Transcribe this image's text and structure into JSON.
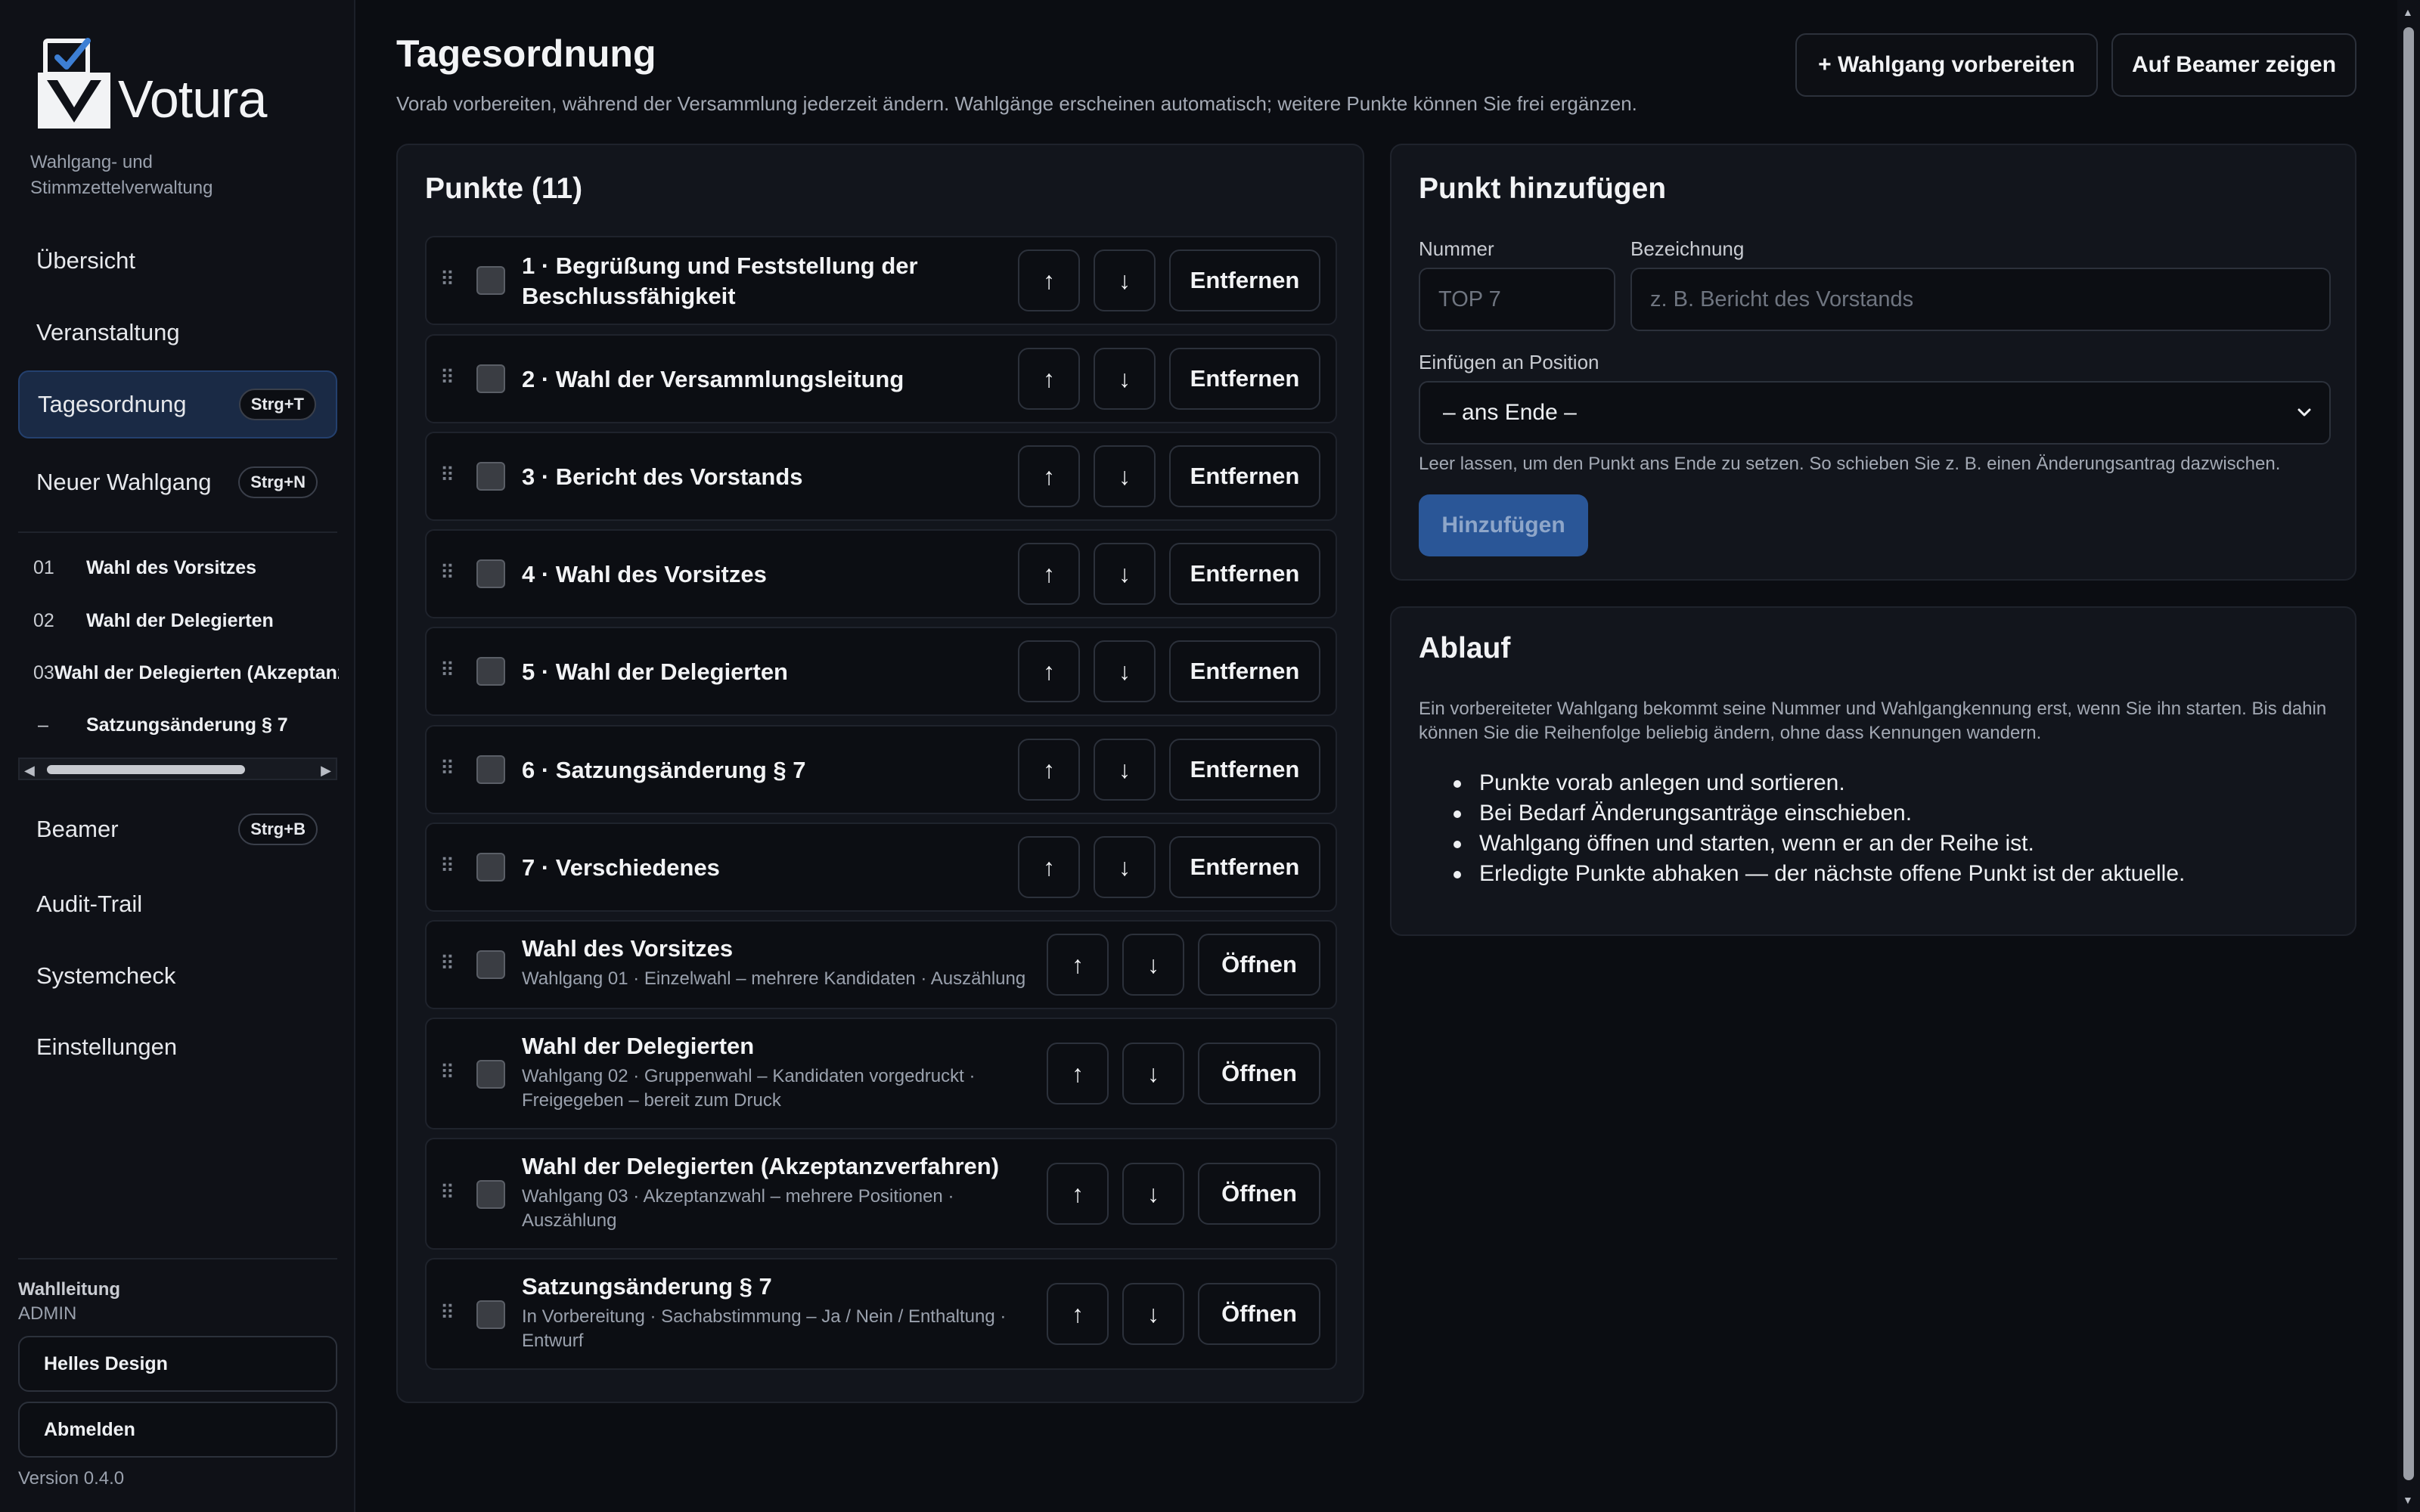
{
  "app": {
    "name": "Votura",
    "tagline": "Wahlgang- und Stimmzettelverwaltung"
  },
  "colors": {
    "background": "#0b0d12",
    "sidebar": "#0f1117",
    "panel": "#12151c",
    "accent": "#2a5697",
    "active_nav": "#1a2a45",
    "logo_check": "#3d7fd4"
  },
  "sidebar": {
    "nav": [
      {
        "label": "Übersicht"
      },
      {
        "label": "Veranstaltung"
      },
      {
        "label": "Tagesordnung",
        "shortcut": "Strg+T",
        "active": true
      },
      {
        "label": "Neuer Wahlgang",
        "shortcut": "Strg+N"
      }
    ],
    "ballots": [
      {
        "num": "01",
        "label": "Wahl des Vorsitzes"
      },
      {
        "num": "02",
        "label": "Wahl der Delegierten"
      },
      {
        "num": "03",
        "label": "Wahl der Delegierten (Akzeptanzverfahren)"
      },
      {
        "num": "–",
        "label": "Satzungsänderung § 7"
      }
    ],
    "nav2": [
      {
        "label": "Beamer",
        "shortcut": "Strg+B"
      },
      {
        "label": "Audit-Trail"
      },
      {
        "label": "Systemcheck"
      },
      {
        "label": "Einstellungen"
      }
    ],
    "user_role": "Wahlleitung",
    "user_name": "ADMIN",
    "theme_button": "Helles Design",
    "logout_button": "Abmelden",
    "version": "Version 0.4.0"
  },
  "header": {
    "title": "Tagesordnung",
    "subtitle": "Vorab vorbereiten, während der Versammlung jederzeit ändern. Wahlgänge erscheinen automatisch; weitere Punkte können Sie frei ergänzen.",
    "prepare_button": "+ Wahlgang vorbereiten",
    "beamer_button": "Auf Beamer zeigen"
  },
  "agenda": {
    "title": "Punkte (11)",
    "up_icon": "↑",
    "down_icon": "↓",
    "remove_label": "Entfernen",
    "open_label": "Öffnen",
    "items": [
      {
        "title_line1": "1 · Begrüßung und Feststellung der",
        "title_line2": "Beschlussfähigkeit"
      },
      {
        "title": "2 · Wahl der Versammlungsleitung"
      },
      {
        "title": "3 · Bericht des Vorstands"
      },
      {
        "title": "4 · Wahl des Vorsitzes"
      },
      {
        "title": "5 · Wahl der Delegierten"
      },
      {
        "title": "6 · Satzungsänderung § 7"
      },
      {
        "title": "7 · Verschiedenes"
      }
    ],
    "ballots": [
      {
        "title": "Wahl des Vorsitzes",
        "meta1": "Wahlgang 01 · Einzelwahl – mehrere Kandidaten · Auszählung"
      },
      {
        "title": "Wahl der Delegierten",
        "meta1": "Wahlgang 02 · Gruppenwahl – Kandidaten vorgedruckt ·",
        "meta2": "Freigegeben – bereit zum Druck"
      },
      {
        "title": "Wahl der Delegierten (Akzeptanzverfahren)",
        "meta1": "Wahlgang 03 · Akzeptanzwahl – mehrere Positionen ·",
        "meta2": "Auszählung"
      },
      {
        "title": "Satzungsänderung § 7",
        "meta1": "In Vorbereitung · Sachabstimmung – Ja / Nein / Enthaltung ·",
        "meta2": "Entwurf"
      }
    ]
  },
  "add_form": {
    "title": "Punkt hinzufügen",
    "number_label": "Nummer",
    "number_placeholder": "TOP 7",
    "name_label": "Bezeichnung",
    "name_placeholder": "z. B. Bericht des Vorstands",
    "position_label": "Einfügen an Position",
    "position_value": "– ans Ende –",
    "hint": "Leer lassen, um den Punkt ans Ende zu setzen. So schieben Sie z. B. einen Änderungsantrag dazwischen.",
    "submit": "Hinzufügen"
  },
  "ablauf": {
    "title": "Ablauf",
    "text_line1": "Ein vorbereiteter Wahlgang bekommt seine Nummer und Wahlgangkennung erst, wenn Sie ihn starten. Bis dahin",
    "text_line2": "können Sie die Reihenfolge beliebig ändern, ohne dass Kennungen wandern.",
    "bullets": [
      "Punkte vorab anlegen und sortieren.",
      "Bei Bedarf Änderungsanträge einschieben.",
      "Wahlgang öffnen und starten, wenn er an der Reihe ist.",
      "Erledigte Punkte abhaken — der nächste offene Punkt ist der aktuelle."
    ]
  }
}
